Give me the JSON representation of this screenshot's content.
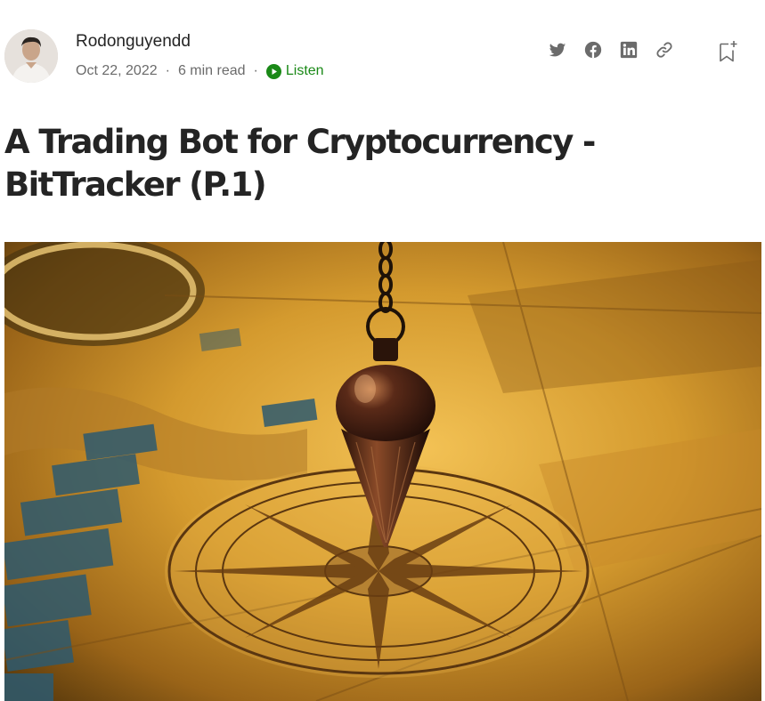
{
  "author": {
    "name": "Rodonguyendd",
    "avatar_icon": "author-avatar"
  },
  "meta": {
    "date": "Oct 22, 2022",
    "separator": "·",
    "read_time": "6 min read",
    "listen_label": "Listen"
  },
  "share_icons": [
    "twitter-icon",
    "facebook-icon",
    "linkedin-icon",
    "link-icon"
  ],
  "save_icon": "bookmark-add-icon",
  "article": {
    "title": "A Trading Bot for Cryptocurrency - BitTracker (P.1)"
  },
  "hero_image": {
    "description_icon": "pendulum-over-compass-map-image"
  },
  "colors": {
    "text": "#242424",
    "muted": "#6b6b6b",
    "listen_green": "#1a8917",
    "icon_gray": "#6b6b6b"
  }
}
